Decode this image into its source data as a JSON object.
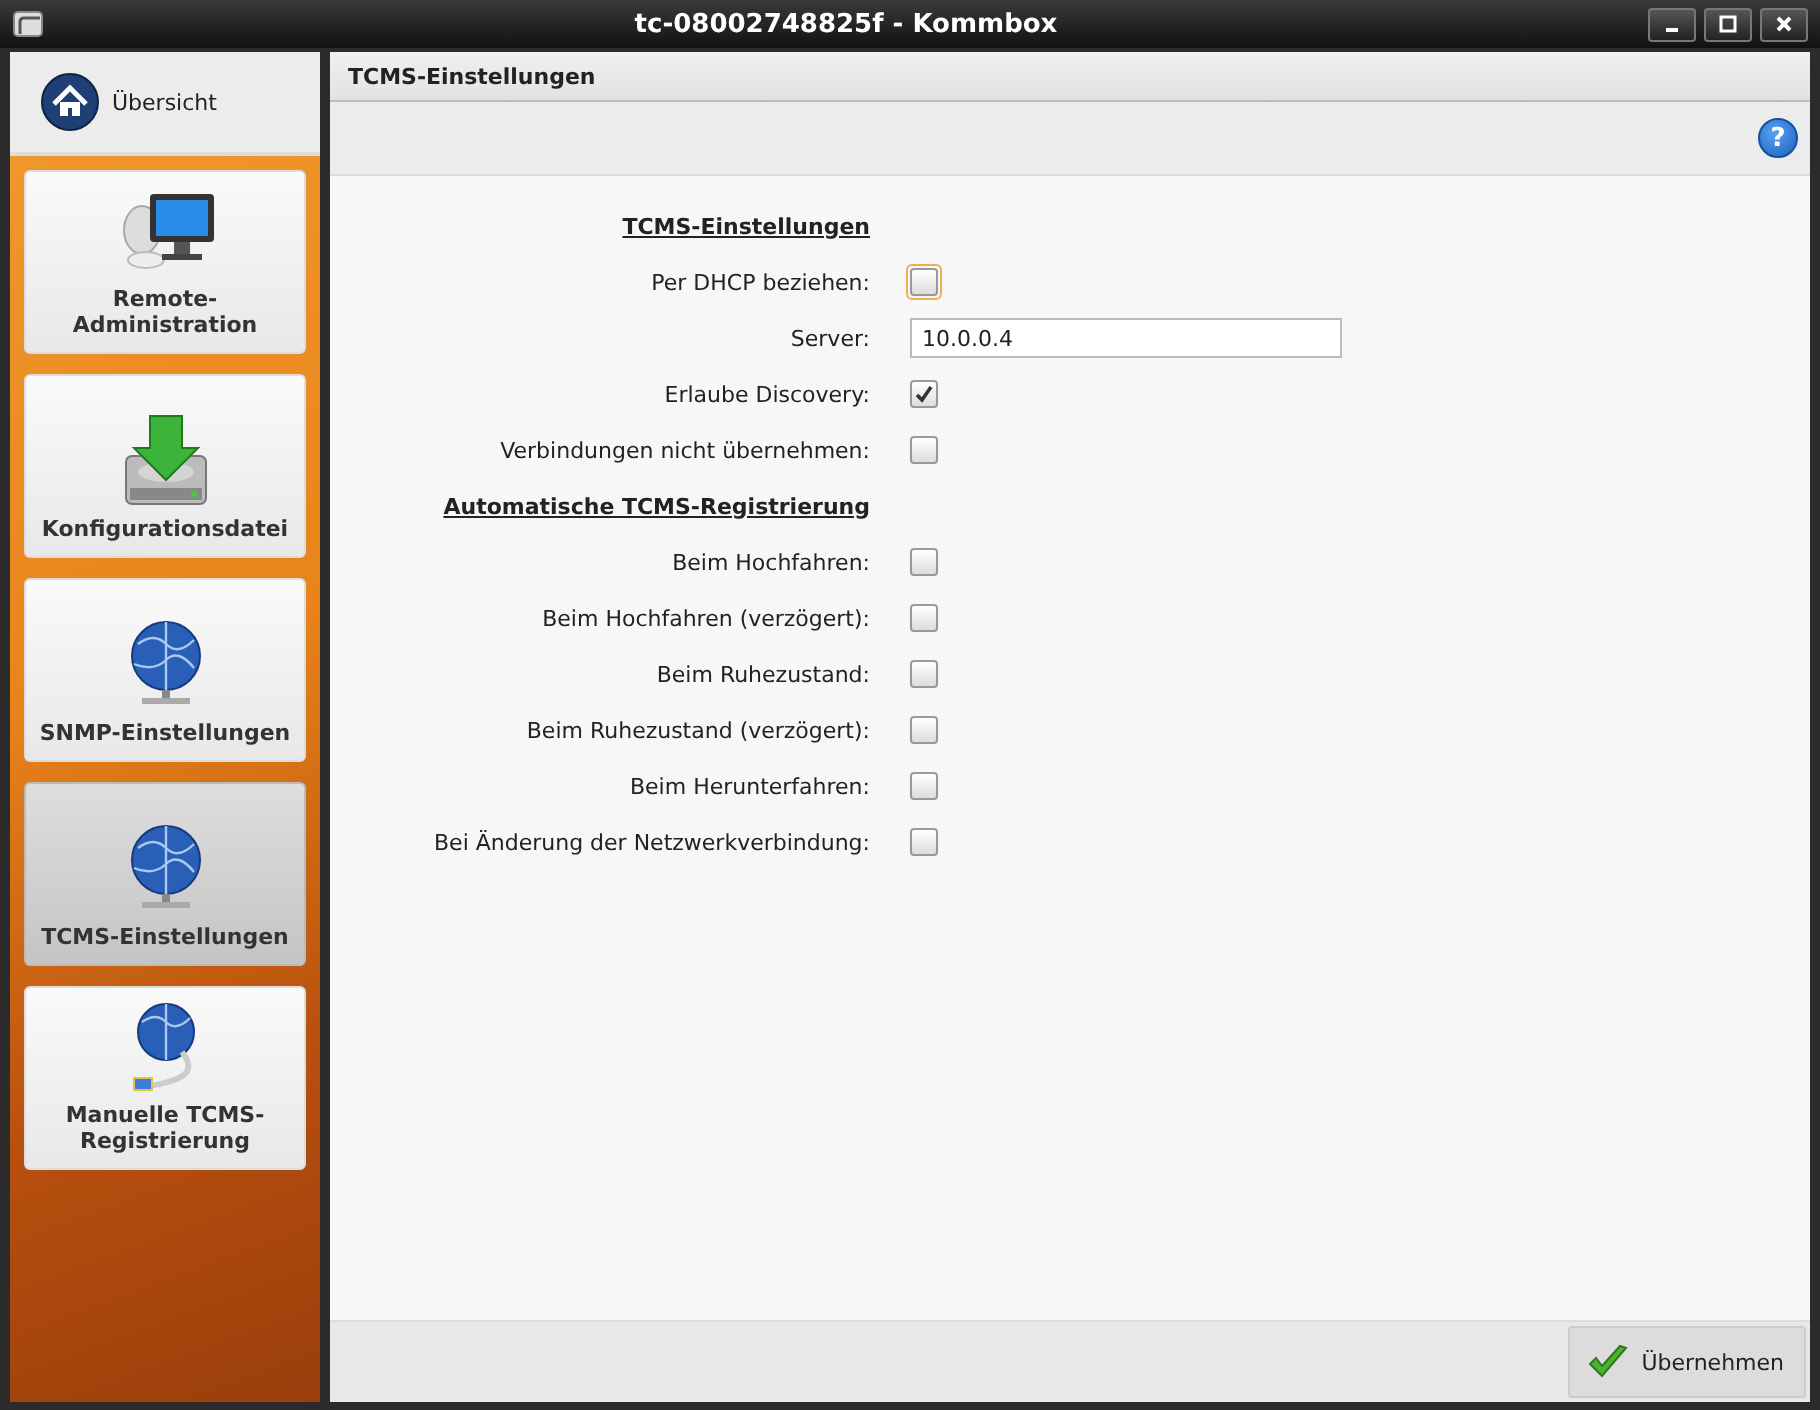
{
  "window": {
    "title": "tc-08002748825f - Kommbox"
  },
  "sidebar": {
    "overview": {
      "label": "Übersicht"
    },
    "items": [
      {
        "label": "Remote-Administration",
        "selected": false
      },
      {
        "label": "Konfigurationsdatei",
        "selected": false
      },
      {
        "label": "SNMP-Einstellungen",
        "selected": false
      },
      {
        "label": "TCMS-Einstellungen",
        "selected": true
      },
      {
        "label": "Manuelle TCMS-Registrierung",
        "selected": false
      }
    ]
  },
  "panel": {
    "title": "TCMS-Einstellungen"
  },
  "toolbar": {
    "help": "?"
  },
  "form": [
    {
      "kind": "heading",
      "label": "TCMS-Einstellungen"
    },
    {
      "kind": "checkbox",
      "label": "Per DHCP beziehen:",
      "checked": false,
      "focused": true
    },
    {
      "kind": "text",
      "label": "Server:",
      "value": "10.0.0.4"
    },
    {
      "kind": "checkbox",
      "label": "Erlaube Discovery:",
      "checked": true,
      "focused": false
    },
    {
      "kind": "checkbox",
      "label": "Verbindungen nicht übernehmen:",
      "checked": false,
      "focused": false
    },
    {
      "kind": "heading",
      "label": "Automatische TCMS-Registrierung"
    },
    {
      "kind": "checkbox",
      "label": "Beim Hochfahren:",
      "checked": false,
      "focused": false
    },
    {
      "kind": "checkbox",
      "label": "Beim Hochfahren (verzögert):",
      "checked": false,
      "focused": false
    },
    {
      "kind": "checkbox",
      "label": "Beim Ruhezustand:",
      "checked": false,
      "focused": false
    },
    {
      "kind": "checkbox",
      "label": "Beim Ruhezustand (verzögert):",
      "checked": false,
      "focused": false
    },
    {
      "kind": "checkbox",
      "label": "Beim Herunterfahren:",
      "checked": false,
      "focused": false
    },
    {
      "kind": "checkbox",
      "label": "Bei Änderung der Netzwerkverbindung:",
      "checked": false,
      "focused": false
    }
  ],
  "buttons": [
    {
      "label": "Übernehmen"
    }
  ]
}
